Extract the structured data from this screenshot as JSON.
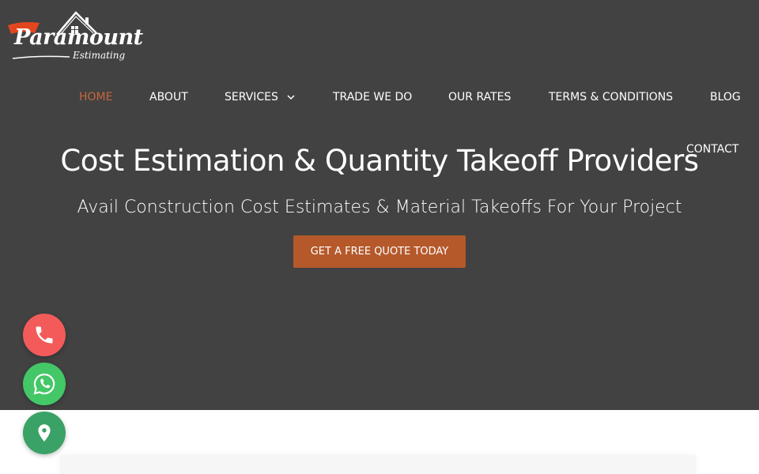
{
  "brand": {
    "name_main": "Paramount",
    "name_sub": "Estimating",
    "accent_color": "#e2461f"
  },
  "nav": {
    "items": [
      {
        "label": "HOME",
        "active": true
      },
      {
        "label": "ABOUT"
      },
      {
        "label": "SERVICES",
        "has_dropdown": true
      },
      {
        "label": "TRADE WE DO"
      },
      {
        "label": "OUR RATES"
      },
      {
        "label": "TERMS & CONDITIONS"
      },
      {
        "label": "BLOG"
      },
      {
        "label": "CONTACT"
      }
    ]
  },
  "hero": {
    "headline": "Cost Estimation & Quantity Takeoff Providers",
    "subheadline": "Avail Construction Cost Estimates & Material Takeoffs For Your Project",
    "cta_label": "GET A FREE QUOTE TODAY",
    "background_color": "#424242",
    "cta_color": "#b5592b"
  },
  "floating_buttons": [
    {
      "icon": "phone-icon",
      "color": "#f35b5b"
    },
    {
      "icon": "whatsapp-icon",
      "color": "#44c767"
    },
    {
      "icon": "location-pin-icon",
      "color": "#3aa266"
    }
  ]
}
